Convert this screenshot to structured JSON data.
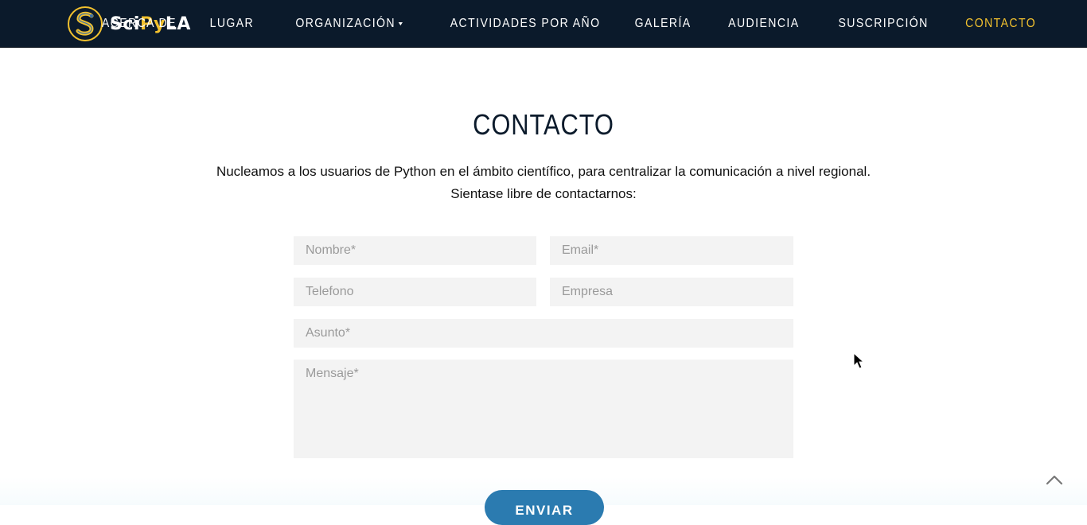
{
  "brand": {
    "name_prefix": "Sci",
    "name_middle": "Py",
    "name_suffix": "LA",
    "logo_icon": "scipyla-snake-s-logo"
  },
  "nav": {
    "items": [
      {
        "label": "ACERCA DE"
      },
      {
        "label": "LUGAR"
      },
      {
        "label": "ORGANIZACIÓN",
        "has_dropdown": true
      },
      {
        "label": "ACTIVIDADES POR AÑO"
      },
      {
        "label": "GALERÍA"
      },
      {
        "label": "AUDIENCIA"
      },
      {
        "label": "SUSCRIPCIÓN"
      },
      {
        "label": "CONTACTO",
        "active": true
      }
    ]
  },
  "main": {
    "title": "CONTACTO",
    "intro_line1": "Nucleamos a los usuarios de Python en el ámbito científico, para centralizar la comunicación a nivel regional.",
    "intro_line2": "Sientase libre de contactarnos:"
  },
  "form": {
    "name_placeholder": "Nombre*",
    "email_placeholder": "Email*",
    "phone_placeholder": "Telefono",
    "company_placeholder": "Empresa",
    "subject_placeholder": "Asunto*",
    "message_placeholder": "Mensaje*",
    "submit_label": "ENVIAR"
  },
  "icons": {
    "scroll_top": "chevron-up-icon",
    "dropdown_caret": "caret-down-icon",
    "pointer": "mouse-cursor-icon"
  },
  "colors": {
    "navbar_bg": "#0b1a2b",
    "accent": "#f2c12e",
    "button": "#2b7bb0",
    "field_bg": "#f3f3f3"
  }
}
